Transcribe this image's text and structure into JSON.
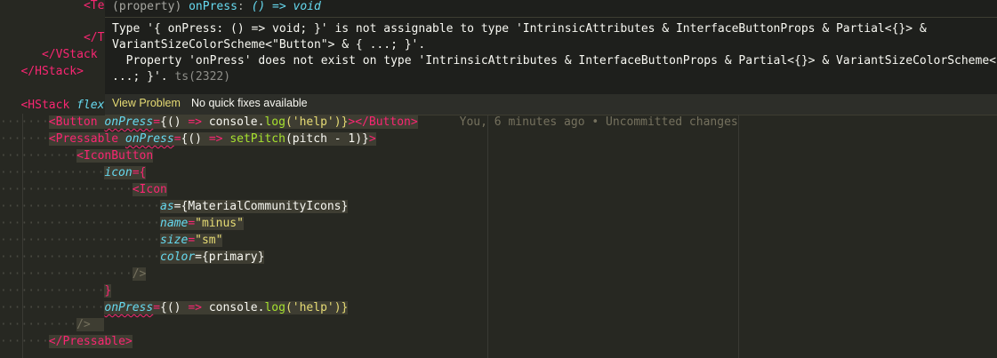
{
  "editor": {
    "partial_lines": {
      "l1": "<Tex",
      "l2": "</Te",
      "l3": "</VStack",
      "l4": "</HStack>",
      "l5_tag": "<HStack",
      "l5_attr": "flex"
    },
    "lines": {
      "button_open": "<Button",
      "button_attr": "onPress",
      "button_eq": "=",
      "button_val1": "{()",
      "button_arrow": "=>",
      "button_console": "console",
      "button_dot": ".",
      "button_log": "log",
      "button_args": "('help')}",
      "button_close": "></Button>",
      "pressable_open": "<Pressable",
      "pressable_attr": "onPress",
      "pressable_eq": "=",
      "pressable_val1": "{()",
      "pressable_arrow": "=>",
      "pressable_fn": "setPitch",
      "pressable_args": "(pitch - 1)}",
      "pressable_gt": ">",
      "iconbutton_open": "<IconButton",
      "icon_attr": "icon",
      "icon_eq": "={",
      "icon_tag": "<Icon",
      "as_attr": "as",
      "as_val": "={MaterialCommunityIcons}",
      "name_attr": "name",
      "name_val": "\"minus\"",
      "size_attr": "size",
      "size_val": "\"sm\"",
      "color_attr": "color",
      "color_val": "={primary}",
      "selfclose": "/>",
      "brace_close": "}",
      "onpress2_attr": "onPress",
      "onpress2_eq": "=",
      "onpress2_val1": "{()",
      "onpress2_arrow": "=>",
      "onpress2_console": "console",
      "onpress2_dot": ".",
      "onpress2_log": "log",
      "onpress2_args": "('help')}",
      "selfclose2": "/>",
      "pressable_close": "</Pressable>"
    },
    "blame": "You, 6 minutes ago • Uncommitted changes"
  },
  "hover": {
    "sig_kind": "(property)",
    "sig_name": "onPress",
    "sig_colon": ":",
    "sig_type": "() => void",
    "message_line1": "Type '{ onPress: () => void; }' is not assignable to type 'IntrinsicAttributes & InterfaceButtonProps & Partial<{}> &",
    "message_line2": "VariantSizeColorScheme<\"Button\"> & { ...; }'.",
    "message_line3": "  Property 'onPress' does not exist on type 'IntrinsicAttributes & InterfaceButtonProps & Partial<{}> & VariantSizeColorScheme<\"Button\">",
    "message_line4": "...; }'.",
    "error_code": "ts(2322)",
    "view_problem": "View Problem",
    "no_quick_fixes": "No quick fixes available"
  },
  "colors": {
    "background": "#272822",
    "tag": "#f92672",
    "attribute": "#66d9ef",
    "string": "#e6db74",
    "function": "#a6e22e",
    "comment": "#75715e"
  }
}
